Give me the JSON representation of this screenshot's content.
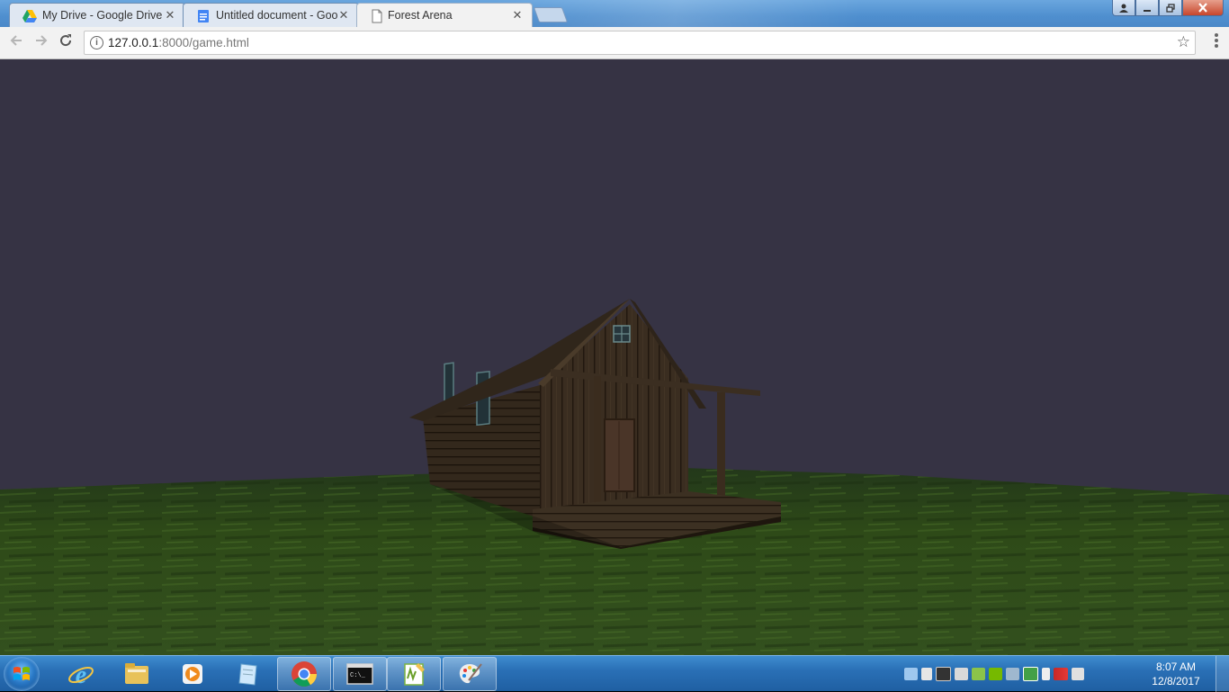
{
  "browser": {
    "tabs": [
      {
        "title": "My Drive - Google Drive",
        "icon": "google-drive-icon"
      },
      {
        "title": "Untitled document - Goo",
        "icon": "google-docs-icon"
      },
      {
        "title": "Forest Arena",
        "icon": "page-icon",
        "active": true
      }
    ],
    "close_glyph": "✕",
    "url_host": "127.0.0.1",
    "url_rest": ":8000/game.html"
  },
  "taskbar": {
    "apps": [
      {
        "name": "internet-explorer"
      },
      {
        "name": "file-explorer"
      },
      {
        "name": "media-player"
      },
      {
        "name": "notepad"
      },
      {
        "name": "google-chrome",
        "open": true
      },
      {
        "name": "command-prompt",
        "open": true
      },
      {
        "name": "notepad-plus-plus",
        "open": true
      },
      {
        "name": "paint",
        "open": true
      }
    ],
    "clock_time": "8:07 AM",
    "clock_date": "12/8/2017"
  },
  "colors": {
    "sky": "#363344",
    "grass": "#2b4016",
    "cabin_wood": "#3a2c1f",
    "taskbar": "#2a70b6"
  }
}
